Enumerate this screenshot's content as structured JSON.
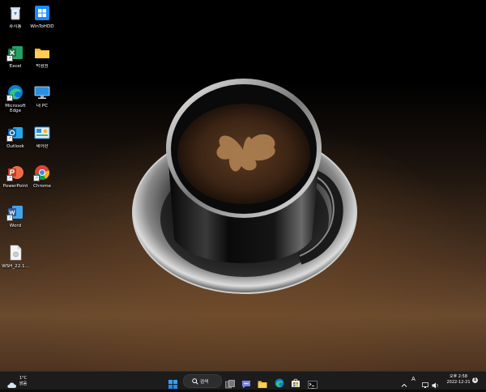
{
  "desktop_icons": [
    {
      "label": "휴지통",
      "icon": "recycle-bin-icon"
    },
    {
      "label": "WinToHDD",
      "icon": "wintohdd-icon"
    },
    {
      "label": "Excel",
      "icon": "excel-icon"
    },
    {
      "label": "박형원",
      "icon": "folder-icon"
    },
    {
      "label": "Microsoft Edge",
      "icon": "edge-icon"
    },
    {
      "label": "내 PC",
      "icon": "this-pc-icon"
    },
    {
      "label": "Outlook",
      "icon": "outlook-icon"
    },
    {
      "label": "제어판",
      "icon": "control-panel-icon"
    },
    {
      "label": "PowerPoint",
      "icon": "powerpoint-icon"
    },
    {
      "label": "Chrome",
      "icon": "chrome-icon"
    },
    {
      "label": "Word",
      "icon": "word-icon"
    },
    {
      "label": "WSH_22.1...",
      "icon": "file-icon"
    }
  ],
  "taskbar": {
    "weather": {
      "temp": "1°C",
      "condition": "맑음",
      "icon": "weather-cloud-icon"
    },
    "search_label": "검색",
    "pinned": [
      "start-icon",
      "search-icon",
      "task-view-icon",
      "chat-icon",
      "file-explorer-icon",
      "edge-icon",
      "store-icon",
      "terminal-icon"
    ],
    "tray": {
      "ime": "A",
      "time": "오후 2:58",
      "date": "2022-12-21",
      "notification_count": "1"
    }
  },
  "colors": {
    "taskbar_bg": "#1c1c1c",
    "excel": "#1d6f42",
    "word": "#2b579a",
    "powerpoint": "#d24726",
    "outlook": "#0a64ad",
    "windows_blue": "#1a8cff"
  }
}
